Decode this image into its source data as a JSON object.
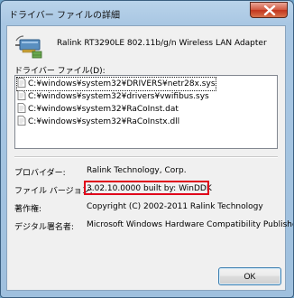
{
  "window": {
    "title": "ドライバー ファイルの詳細"
  },
  "adapter": {
    "name": "Ralink RT3290LE 802.11b/g/n Wireless LAN Adapter"
  },
  "driver_files": {
    "label": "ドライバー ファイル(D):",
    "items": [
      "C:¥windows¥system32¥DRIVERS¥netr28x.sys",
      "C:¥windows¥system32¥drivers¥vwifibus.sys",
      "C:¥windows¥system32¥RaCoInst.dat",
      "C:¥windows¥system32¥RaCoInstx.dll"
    ],
    "selected_index": 0
  },
  "properties": {
    "provider_label": "プロバイダー:",
    "provider_value": "Ralink Technology, Corp.",
    "version_label": "ファイル バージョン:",
    "version_value": "3.02.10.0000 built by: WinDDK",
    "copyright_label": "著作権:",
    "copyright_value": "Copyright (C) 2002-2011 Ralink Technology",
    "signer_label": "デジタル署名者:",
    "signer_value": "Microsoft Windows Hardware Compatibility Publisher"
  },
  "buttons": {
    "ok": "OK"
  },
  "icons": {
    "close": "close-icon",
    "adapter": "network-adapter-icon",
    "file": "file-icon"
  },
  "colors": {
    "highlight": "#e0001b",
    "close_button": "#c2341c",
    "titlebar": "#a9c7e3"
  }
}
